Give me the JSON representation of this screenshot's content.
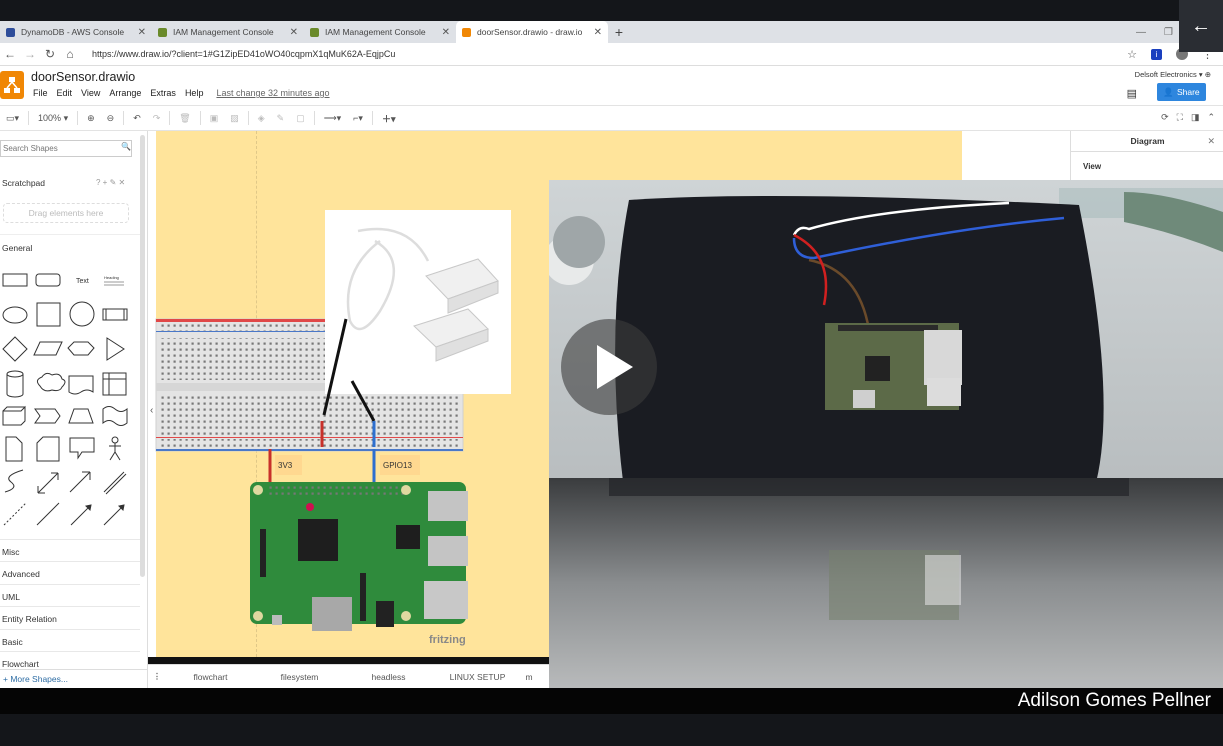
{
  "browser": {
    "tabs": [
      {
        "label": "DynamoDB - AWS Console",
        "color": "#2e4d9a"
      },
      {
        "label": "IAM Management Console",
        "color": "#6a8a2a"
      },
      {
        "label": "IAM Management Console",
        "color": "#6a8a2a"
      },
      {
        "label": "doorSensor.drawio - draw.io",
        "color": "#f08705"
      }
    ],
    "url": "https://www.draw.io/?client=1#G1ZipED41oWO40cqpmX1qMuK62A-EqjpCu"
  },
  "app": {
    "title": "doorSensor.drawio",
    "menu": [
      "File",
      "Edit",
      "View",
      "Arrange",
      "Extras",
      "Help"
    ],
    "last_change": "Last change 32 minutes ago",
    "org": "Delsoft Electronics",
    "share_label": "Share"
  },
  "toolbar": {
    "zoom": "100%"
  },
  "shapes_panel": {
    "search_placeholder": "Search Shapes",
    "scratchpad": "Scratchpad",
    "drag_hint": "Drag elements here",
    "general": "General",
    "text_shape_label": "Text",
    "heading_shape_label": "Heading",
    "sections": [
      "Misc",
      "Advanced",
      "UML",
      "Entity Relation",
      "Basic",
      "Flowchart"
    ],
    "more_shapes": "More Shapes..."
  },
  "diagram": {
    "label_3v3": "3V3",
    "label_gpio": "GPIO13",
    "fritzing": "fritzing"
  },
  "format_panel": {
    "tab": "Diagram",
    "view": "View"
  },
  "pages": [
    "flowchart",
    "filesystem",
    "headless",
    "LINUX SETUP",
    "m"
  ],
  "caption": "Adilson Gomes Pellner"
}
